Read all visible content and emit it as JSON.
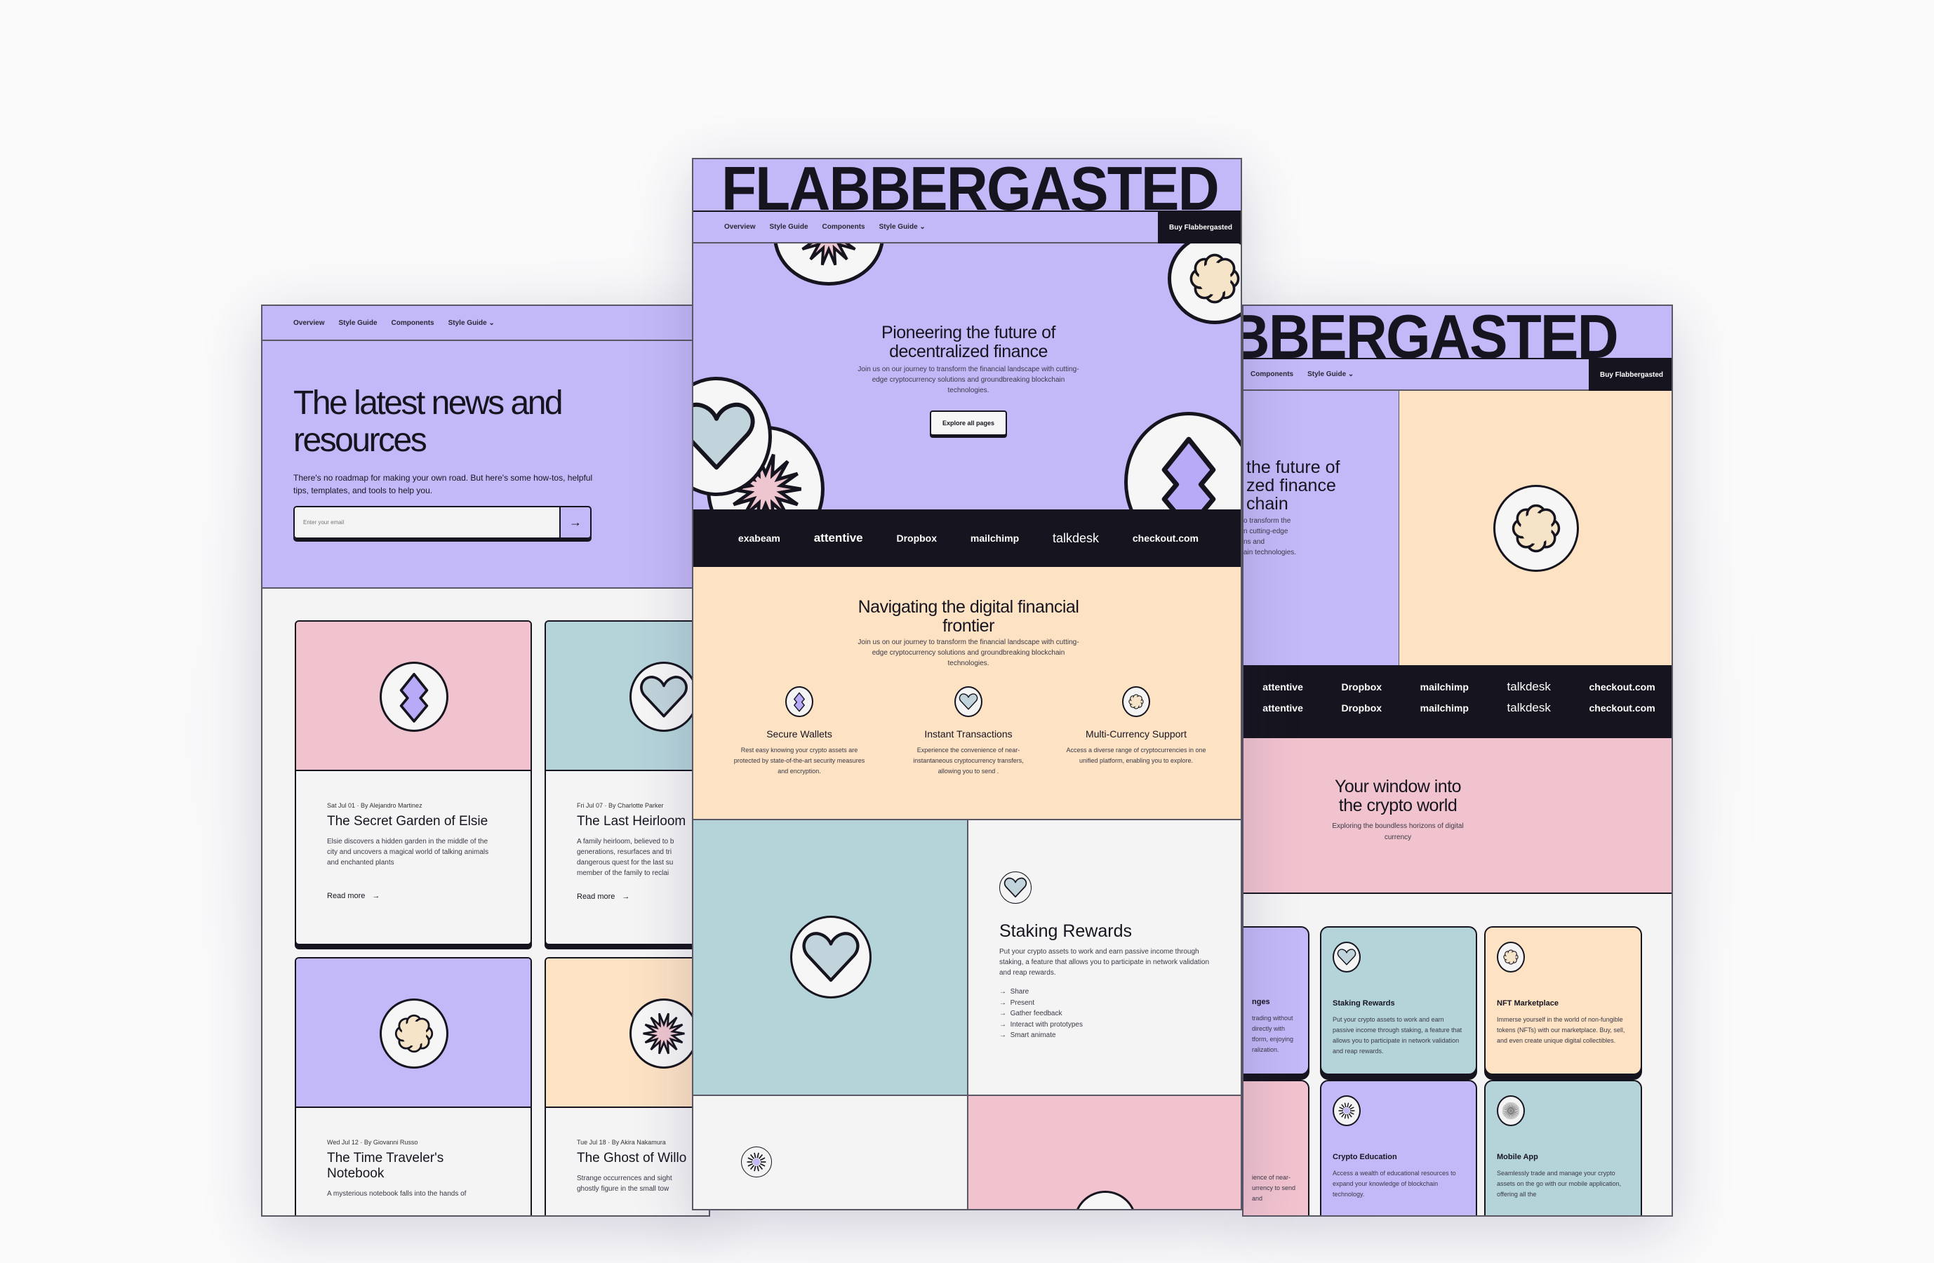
{
  "brand": "FLABBERGASTED",
  "nav": {
    "items": [
      "Overview",
      "Style Guide",
      "Components",
      "Style Guide"
    ],
    "dropdown_icon": "chevron-down-icon",
    "buy_label": "Buy Flabbergasted"
  },
  "colors": {
    "lavender": "#c4b9f8",
    "peach": "#fde2c4",
    "teal": "#b5d4da",
    "pink": "#f1c3cf",
    "dark": "#16151f"
  },
  "blog": {
    "title": "The latest news and resources",
    "subtitle": "There's no roadmap for making your own road. But here's some how-tos, helpful tips, templates, and tools to help you.",
    "email_placeholder": "Enter your email",
    "posts": [
      {
        "meta": "Sat Jul 01 · By Alejandro Martinez",
        "title": "The Secret Garden of Elsie",
        "desc": "Elsie discovers a hidden garden in the middle of the city and uncovers a magical world of talking animals and enchanted plants",
        "read_more": "Read more",
        "icon": "diamond"
      },
      {
        "meta": "Fri Jul 07 · By Charlotte Parker",
        "title": "The Last Heirloom",
        "desc": "A family heirloom, believed to b generations, resurfaces and tri dangerous quest for the last su member of the family to reclai",
        "read_more": "Read more",
        "icon": "heart"
      },
      {
        "meta": "Wed Jul 12 · By Giovanni Russo",
        "title": "The Time Traveler's Notebook",
        "desc": "A mysterious notebook falls into the hands of",
        "icon": "flower"
      },
      {
        "meta": "Tue Jul 18 · By Akira Nakamura",
        "title": "The Ghost of Willo",
        "desc": "Strange occurrences and sight ghostly figure in the small tow",
        "icon": "starburst"
      }
    ]
  },
  "home": {
    "hero_title": "Pioneering the future of decentralized finance",
    "hero_text": "Join us on our journey to transform the financial landscape with cutting-edge cryptocurrency solutions and groundbreaking blockchain technologies.",
    "cta": "Explore all pages",
    "logos": [
      "exabeam",
      "attentive",
      "Dropbox",
      "mailchimp",
      "talkdesk",
      "checkout.com"
    ],
    "section_title": "Navigating the digital financial frontier",
    "section_text": "Join us on our journey to transform the financial landscape with cutting-edge cryptocurrency solutions and groundbreaking blockchain technologies.",
    "features": [
      {
        "title": "Secure Wallets",
        "desc": "Rest easy knowing your crypto assets are protected by state-of-the-art security measures and encryption.",
        "icon": "diamond"
      },
      {
        "title": "Instant Transactions",
        "desc": "Experience the convenience of near-instantaneous cryptocurrency transfers, allowing you to send .",
        "icon": "heart"
      },
      {
        "title": "Multi-Currency Support",
        "desc": "Access a diverse range of cryptocurrencies in one unified platform, enabling you to explore.",
        "icon": "flower"
      }
    ],
    "staking": {
      "title": "Staking Rewards",
      "desc": "Put your crypto assets to work and earn passive income through staking, a feature that allows you to participate in network validation and reap rewards.",
      "list": [
        "Share",
        "Present",
        "Gather feedback",
        "Interact with prototypes",
        "Smart animate"
      ]
    }
  },
  "alt": {
    "hero_fragments": [
      "the future of",
      "zed finance",
      "chain"
    ],
    "hero_text_fragments": [
      "o transform the",
      "n cutting-edge",
      "ns and",
      "ain technologies."
    ],
    "window_title": "Your window into the crypto world",
    "window_text": "Exploring the boundless horizons of digital currency",
    "cards": [
      {
        "title": "nges",
        "desc": "trading without directly with tform, enjoying ralization."
      },
      {
        "title": "Staking Rewards",
        "desc": "Put your crypto assets to work and earn passive income through staking, a feature that allows you to participate in network validation and reap rewards.",
        "icon": "heart"
      },
      {
        "title": "NFT Marketplace",
        "desc": "Immerse yourself in the world of non-fungible tokens (NFTs) with our marketplace. Buy, sell, and even create unique digital collectibles.",
        "icon": "flower"
      },
      {
        "desc": "ience of near- urrency to send and"
      },
      {
        "title": "Crypto Education",
        "desc": "Access a wealth of educational resources to expand your knowledge of blockchain technology.",
        "icon": "sun"
      },
      {
        "title": "Mobile App",
        "desc": "Seamlessly trade and manage your crypto assets on the go with our mobile application, offering all the",
        "icon": "burst"
      }
    ]
  }
}
